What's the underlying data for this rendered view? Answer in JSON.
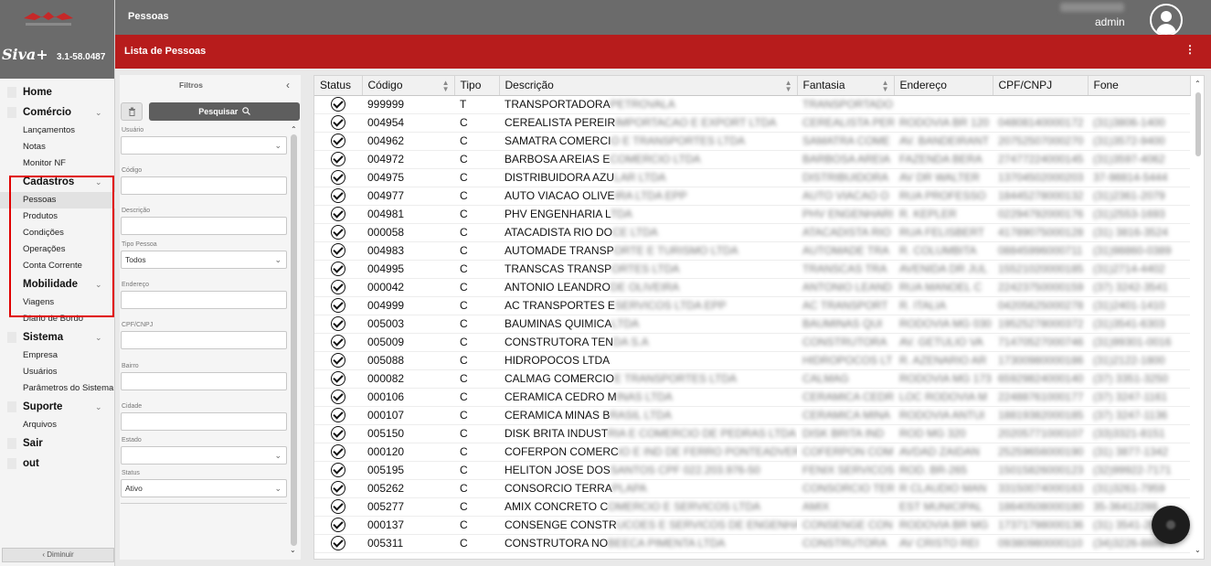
{
  "brand": {
    "name": "Siva+",
    "version": "3.1-58.0487"
  },
  "header": {
    "page_title": "Pessoas",
    "user": "admin"
  },
  "list": {
    "title": "Lista de Pessoas",
    "menu_icon": "more-vert-icon"
  },
  "sidebar": {
    "sections": [
      {
        "label": "Home",
        "items": []
      },
      {
        "label": "Comércio",
        "items": [
          "Lançamentos",
          "Notas",
          "Monitor NF"
        ]
      },
      {
        "label": "Cadastros",
        "items": [
          "Pessoas",
          "Produtos",
          "Condições",
          "Operações",
          "Conta Corrente"
        ]
      },
      {
        "label": "Mobilidade",
        "items": [
          "Viagens",
          "Diario de Bordo"
        ]
      },
      {
        "label": "Sistema",
        "items": [
          "Empresa",
          "Usuários",
          "Parâmetros do Sistema"
        ]
      },
      {
        "label": "Suporte",
        "items": [
          "Arquivos"
        ]
      },
      {
        "label": "Sair",
        "items": []
      },
      {
        "label": "out",
        "items": []
      }
    ],
    "active_item": "Pessoas",
    "collapse_label": "Diminuir"
  },
  "filters": {
    "title": "Filtros",
    "search_label": "Pesquisar",
    "usuario_label": "Usuário",
    "usuario_value": "",
    "codigo_label": "Código",
    "codigo_value": "",
    "descricao_label": "Descrição",
    "descricao_value": "",
    "tipo_label": "Tipo Pessoa",
    "tipo_value": "Todos",
    "endereco_label": "Endereço",
    "endereco_value": "",
    "cpf_label": "CPF/CNPJ",
    "cpf_value": "",
    "bairro_label": "Bairro",
    "bairro_value": "",
    "cidade_label": "Cidade",
    "cidade_value": "",
    "estado_label": "Estado",
    "estado_value": "",
    "status_label": "Status",
    "status_value": "Ativo"
  },
  "table": {
    "columns": [
      "Status",
      "Código",
      "Tipo",
      "Descrição",
      "Fantasia",
      "Endereço",
      "CPF/CNPJ",
      "Fone"
    ],
    "rows": [
      {
        "codigo": "999999",
        "tipo": "T",
        "descricao": "TRANSPORTADORA",
        "desc_blur": "PETROVALA",
        "fantasia": "TRANSPORTADO",
        "endereco": "",
        "cpf": "",
        "fone": ""
      },
      {
        "codigo": "004954",
        "tipo": "C",
        "descricao": "CEREALISTA PEREIR",
        "desc_blur": "IMPORTACAO E EXPORT LTDA",
        "fantasia": "CEREALISTA PER",
        "endereco": "RODOVIA BR 120",
        "cpf": "04808140000172",
        "fone": "(31)3806-1400"
      },
      {
        "codigo": "004962",
        "tipo": "C",
        "descricao": "SAMATRA COMERCI",
        "desc_blur": "O E TRANSPORTES LTDA",
        "fantasia": "SAMATRA COME",
        "endereco": "AV. BANDEIRANT",
        "cpf": "20752507000270",
        "fone": "(31)3572-9400"
      },
      {
        "codigo": "004972",
        "tipo": "C",
        "descricao": "BARBOSA AREIAS E",
        "desc_blur": "COMERCIO LTDA",
        "fantasia": "BARBOSA AREIA",
        "endereco": "FAZENDA BERA",
        "cpf": "27477224000145",
        "fone": "(31)3597-4062"
      },
      {
        "codigo": "004975",
        "tipo": "C",
        "descricao": "DISTRIBUIDORA AZU",
        "desc_blur": "LAR LTDA",
        "fantasia": "DISTRIBUIDORA",
        "endereco": "AV DR WALTER",
        "cpf": "13704502000203",
        "fone": "37-98814-5444"
      },
      {
        "codigo": "004977",
        "tipo": "C",
        "descricao": "AUTO VIACAO OLIVE",
        "desc_blur": "IRA LTDA EPP",
        "fantasia": "AUTO VIACAO O",
        "endereco": "RUA PROFESSO",
        "cpf": "18445278000132",
        "fone": "(31)2361-2079"
      },
      {
        "codigo": "004981",
        "tipo": "C",
        "descricao": "PHV ENGENHARIA L",
        "desc_blur": "TDA",
        "fantasia": "PHV ENGENHARI",
        "endereco": "R. KEPLER",
        "cpf": "02294792000176",
        "fone": "(31)2553-1693"
      },
      {
        "codigo": "000058",
        "tipo": "C",
        "descricao": "ATACADISTA RIO DO",
        "desc_blur": "CE LTDA",
        "fantasia": "ATACADISTA RIO",
        "endereco": "RUA FELISBERT",
        "cpf": "41789075000128",
        "fone": "(31) 3816-3524"
      },
      {
        "codigo": "004983",
        "tipo": "C",
        "descricao": "AUTOMADE TRANSP",
        "desc_blur": "ORTE E TURISMO LTDA",
        "fantasia": "AUTOMADE TRA",
        "endereco": "R. COLUMBITA",
        "cpf": "08845996000711",
        "fone": "(31)98860-0389"
      },
      {
        "codigo": "004995",
        "tipo": "C",
        "descricao": "TRANSCAS TRANSP",
        "desc_blur": "ORTES LTDA",
        "fantasia": "TRANSCAS TRA",
        "endereco": "AVENIDA DR JUL",
        "cpf": "15521020000185",
        "fone": "(31)2714-4402"
      },
      {
        "codigo": "000042",
        "tipo": "C",
        "descricao": "ANTONIO LEANDRO",
        "desc_blur": "DE OLIVEIRA",
        "fantasia": "ANTONIO LEAND",
        "endereco": "RUA MANOEL C",
        "cpf": "22423750000159",
        "fone": "(37) 3242-3541"
      },
      {
        "codigo": "004999",
        "tipo": "C",
        "descricao": "AC TRANSPORTES E",
        "desc_blur": "SERVICOS LTDA EPP",
        "fantasia": "AC TRANSPORT",
        "endereco": "R. ITALIA",
        "cpf": "04205625000278",
        "fone": "(31)2401-1410"
      },
      {
        "codigo": "005003",
        "tipo": "C",
        "descricao": "BAUMINAS QUIMICA",
        "desc_blur": "LTDA",
        "fantasia": "BAUMINAS QUI",
        "endereco": "RODOVIA MG 030",
        "cpf": "19525278000372",
        "fone": "(31)3541-6303"
      },
      {
        "codigo": "005009",
        "tipo": "C",
        "descricao": "CONSTRUTORA TEN",
        "desc_blur": "DA S.A",
        "fantasia": "CONSTRUTORA",
        "endereco": "AV. GETULIO VA",
        "cpf": "71470527000746",
        "fone": "(31)99301-0016"
      },
      {
        "codigo": "005088",
        "tipo": "C",
        "descricao": "HIDROPOCOS LTDA",
        "desc_blur": "",
        "fantasia": "HIDROPOCOS LT",
        "endereco": "R. AZENARIO AR",
        "cpf": "17300980000186",
        "fone": "(31)2122-1800"
      },
      {
        "codigo": "000082",
        "tipo": "C",
        "descricao": "CALMAG COMERCIO",
        "desc_blur": "E TRANSPORTES LTDA",
        "fantasia": "CALMAG",
        "endereco": "RODOVIA MG 173",
        "cpf": "65929824000140",
        "fone": "(37) 3351-3250"
      },
      {
        "codigo": "000106",
        "tipo": "C",
        "descricao": "CERAMICA CEDRO M",
        "desc_blur": "INAS LTDA",
        "fantasia": "CERAMICA CEDR",
        "endereco": "LOC RODOVIA M",
        "cpf": "22488761000177",
        "fone": "(37) 3247-1161"
      },
      {
        "codigo": "000107",
        "tipo": "C",
        "descricao": "CERAMICA MINAS B",
        "desc_blur": "RASIL LTDA",
        "fantasia": "CERAMICA MINA",
        "endereco": "RODOVIA ANTUI",
        "cpf": "18819382000185",
        "fone": "(37) 3247-1136"
      },
      {
        "codigo": "005150",
        "tipo": "C",
        "descricao": "DISK BRITA INDUST",
        "desc_blur": "RIA E COMERCIO DE PEDRAS LTDA",
        "fantasia": "DISK BRITA IND",
        "endereco": "ROD MG 320",
        "cpf": "20205771000107",
        "fone": "(33)3321-8151"
      },
      {
        "codigo": "000120",
        "tipo": "C",
        "descricao": "COFERPON COMERC",
        "desc_blur": "IO E IND DE FERRO PONTEADVERD SA",
        "fantasia": "COFERPON COM",
        "endereco": "AVDAD ZAIDAN",
        "cpf": "25259656000190",
        "fone": "(31) 3877-1342"
      },
      {
        "codigo": "005195",
        "tipo": "C",
        "descricao": "HELITON JOSE DOS",
        "desc_blur": "SANTOS CPF 022.203.976-50",
        "fantasia": "FENIX SERVICOS",
        "endereco": "ROD. BR-265",
        "cpf": "15015826000123",
        "fone": "(32)99922-7171"
      },
      {
        "codigo": "005262",
        "tipo": "C",
        "descricao": "CONSORCIO TERRA",
        "desc_blur": "PLAPA",
        "fantasia": "CONSORCIO TER",
        "endereco": "R CLAUDIO MAN",
        "cpf": "33150074000163",
        "fone": "(31)3261-7959"
      },
      {
        "codigo": "005277",
        "tipo": "C",
        "descricao": "AMIX CONCRETO C",
        "desc_blur": "OMERCIO E SERVICOS LTDA",
        "fantasia": "AMIX",
        "endereco": "EST MUNICIPAL",
        "cpf": "18640508000180",
        "fone": "35-36412288"
      },
      {
        "codigo": "000137",
        "tipo": "C",
        "descricao": "CONSENGE CONSTR",
        "desc_blur": "UCOES E SERVICOS DE ENGENHARIA L",
        "fantasia": "CONSENGE CON",
        "endereco": "RODOVIA BR MG",
        "cpf": "17371798000136",
        "fone": "(31) 3541-2000"
      },
      {
        "codigo": "005311",
        "tipo": "C",
        "descricao": "CONSTRUTORA NO",
        "desc_blur": "BEECA PIMENTA LTDA",
        "fantasia": "CONSTRUTORA",
        "endereco": "AV CRISTO REI",
        "cpf": "09380980000110",
        "fone": "(34)3226-8888"
      }
    ]
  }
}
